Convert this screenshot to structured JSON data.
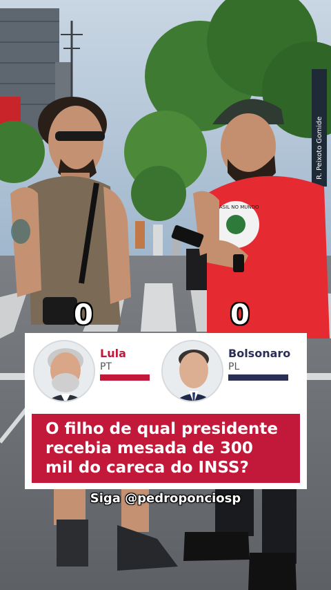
{
  "scores": {
    "left": "0",
    "right": "0"
  },
  "candidates": [
    {
      "name": "Lula",
      "party": "PT",
      "name_color": "#c2183a",
      "bar_color": "#c2183a"
    },
    {
      "name": "Bolsonaro",
      "party": "PL",
      "name_color": "#2a2f56",
      "bar_color": "#2a2f56"
    }
  ],
  "question": {
    "lines": [
      "O filho de qual presidente",
      "recebia mesada de 300",
      "mil do careca do INSS?"
    ],
    "background": "#c2183a"
  },
  "follow_text": "Siga @pedroponciosp",
  "street_sign": "R. Peixoto Gomide",
  "shirt_print": "BRASIL NO MUNDO"
}
